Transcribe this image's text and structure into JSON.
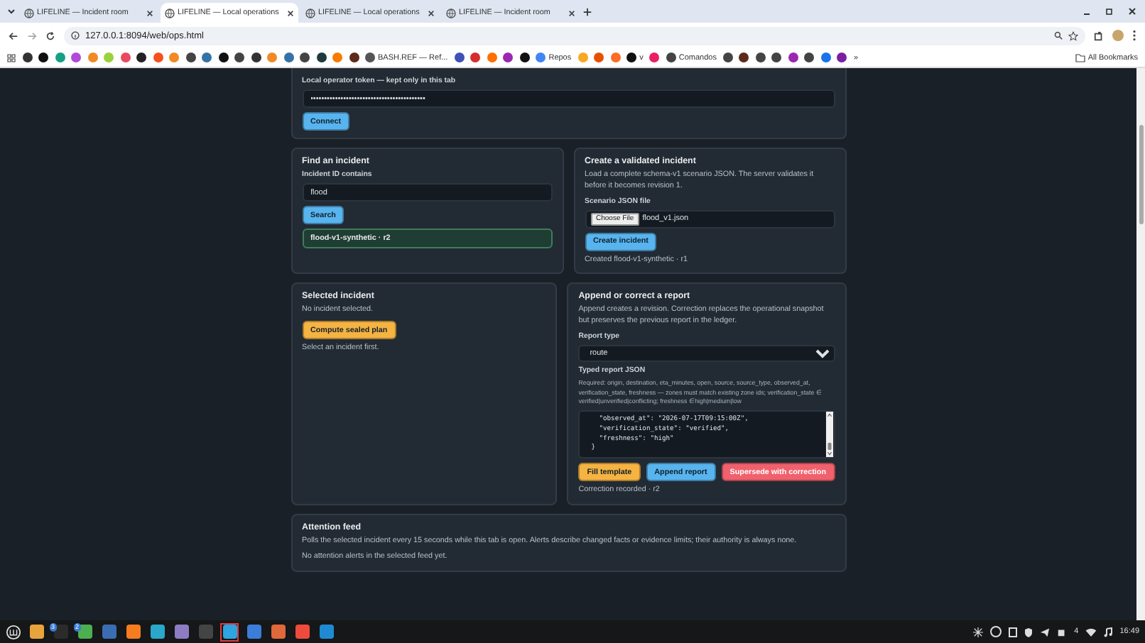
{
  "browser": {
    "tabs": [
      {
        "title": "LIFELINE — Incident room",
        "selected": false
      },
      {
        "title": "LIFELINE — Local operations",
        "selected": true
      },
      {
        "title": "LIFELINE — Local operations",
        "selected": false
      },
      {
        "title": "LIFELINE — Incident room",
        "selected": false
      }
    ],
    "address": "127.0.0.1:8094/web/ops.html",
    "bookmarks": [
      {
        "kind": "icon",
        "color": "#333333"
      },
      {
        "kind": "icon",
        "color": "#111111"
      },
      {
        "kind": "icon",
        "color": "#16a085"
      },
      {
        "kind": "icon",
        "color": "#b04bd8"
      },
      {
        "kind": "icon",
        "color": "#f08a24"
      },
      {
        "kind": "icon",
        "color": "#9bd13b"
      },
      {
        "kind": "icon",
        "color": "#e84a5f"
      },
      {
        "kind": "icon",
        "color": "#222222"
      },
      {
        "kind": "icon",
        "color": "#f4511e"
      },
      {
        "kind": "icon",
        "color": "#f08a24"
      },
      {
        "kind": "icon",
        "color": "#444444"
      },
      {
        "kind": "icon",
        "color": "#3572a5"
      },
      {
        "kind": "icon",
        "color": "#111111"
      },
      {
        "kind": "icon",
        "color": "#444444"
      },
      {
        "kind": "icon",
        "color": "#333333"
      },
      {
        "kind": "icon",
        "color": "#f08a24"
      },
      {
        "kind": "icon",
        "color": "#3572a5"
      },
      {
        "kind": "icon",
        "color": "#444444"
      },
      {
        "kind": "icon",
        "color": "#1e3a3a"
      },
      {
        "kind": "icon",
        "color": "#f57c00"
      },
      {
        "kind": "icon",
        "color": "#5d2a1a"
      },
      {
        "kind": "text",
        "label": "BASH.REF — Ref...",
        "color": "#555555"
      },
      {
        "kind": "icon",
        "color": "#3f51b5"
      },
      {
        "kind": "icon",
        "color": "#d32f2f"
      },
      {
        "kind": "icon",
        "color": "#ff6f00"
      },
      {
        "kind": "icon",
        "color": "#9c27b0"
      },
      {
        "kind": "icon",
        "color": "#111111"
      },
      {
        "kind": "text",
        "label": "Repos",
        "color": "#4285f4"
      },
      {
        "kind": "icon",
        "color": "#f9a825"
      },
      {
        "kind": "icon",
        "color": "#e65100"
      },
      {
        "kind": "icon",
        "color": "#fc6d26"
      },
      {
        "kind": "text",
        "label": "v",
        "color": "#111111"
      },
      {
        "kind": "icon",
        "color": "#e91e63"
      },
      {
        "kind": "text",
        "label": "Comandos",
        "color": "#444444"
      },
      {
        "kind": "icon",
        "color": "#444444"
      },
      {
        "kind": "icon",
        "color": "#5d2a1a"
      },
      {
        "kind": "icon",
        "color": "#444444"
      },
      {
        "kind": "icon",
        "color": "#444444"
      },
      {
        "kind": "icon",
        "color": "#9c27b0"
      },
      {
        "kind": "icon",
        "color": "#444444"
      },
      {
        "kind": "icon",
        "color": "#1a73e8"
      },
      {
        "kind": "icon",
        "color": "#7b1fa2"
      }
    ],
    "overflow": "»",
    "all_bookmarks": "All Bookmarks"
  },
  "connect_panel": {
    "token_label": "Local operator token — kept only in this tab",
    "token_value": "••••••••••••••••••••••••••••••••••••••••••",
    "button": "Connect"
  },
  "find_panel": {
    "title": "Find an incident",
    "field_label": "Incident ID contains",
    "field_value": "flood",
    "button": "Search",
    "results": [
      {
        "label": "flood-v1-synthetic · r2",
        "selected": true
      }
    ]
  },
  "create_panel": {
    "title": "Create a validated incident",
    "description": "Load a complete schema-v1 scenario JSON. The server validates it before it becomes revision 1.",
    "file_label": "Scenario JSON file",
    "file_button": "Choose File",
    "file_name": "flood_v1.json",
    "button": "Create incident",
    "status": "Created flood-v1-synthetic · r1"
  },
  "selected_panel": {
    "title": "Selected incident",
    "status": "No incident selected.",
    "button": "Compute sealed plan",
    "hint": "Select an incident first."
  },
  "report_panel": {
    "title": "Append or correct a report",
    "description": "Append creates a revision. Correction replaces the operational snapshot but preserves the previous report in the ledger.",
    "type_label": "Report type",
    "type_value": "route",
    "json_label": "Typed report JSON",
    "json_help": "Required: origin, destination, eta_minutes, open, source, source_type, observed_at, verification_state, freshness — zones must match existing zone ids; verification_state ∈ verified|unverified|conflicting; freshness ∈ high|medium|low",
    "json_lines": [
      "  \"observed_at\": \"2026-07-17T09:15:00Z\",",
      "  \"verification_state\": \"verified\",",
      "  \"freshness\": \"high\"",
      "}"
    ],
    "buttons": [
      {
        "label": "Fill template",
        "kind": "warning"
      },
      {
        "label": "Append report",
        "kind": "primary"
      },
      {
        "label": "Supersede with correction",
        "kind": "danger"
      }
    ],
    "status": "Correction recorded · r2"
  },
  "attention_panel": {
    "title": "Attention feed",
    "description": "Polls the selected incident every 15 seconds while this tab is open. Alerts describe changed facts or evidence limits; their authority is always none.",
    "status": "No attention alerts in the selected feed yet."
  },
  "taskbar": {
    "apps": [
      {
        "color": "#e8a33d",
        "selected": false
      },
      {
        "color": "#2b2b2b",
        "selected": false,
        "badge": "3"
      },
      {
        "color": "#4caf50",
        "selected": false,
        "badge": "2"
      },
      {
        "color": "#3b6db3",
        "selected": false
      },
      {
        "color": "#f57c20",
        "selected": false
      },
      {
        "color": "#2aa7c9",
        "selected": false
      },
      {
        "color": "#8e7cc3",
        "selected": false
      },
      {
        "color": "#444444",
        "selected": false
      },
      {
        "color": "#2ca5e0",
        "selected": true
      },
      {
        "color": "#3b7dd8",
        "selected": false
      },
      {
        "color": "#e0683a",
        "selected": false
      },
      {
        "color": "#ef4b3c",
        "selected": false
      },
      {
        "color": "#1f8ad2",
        "selected": false
      }
    ],
    "tray_count": "4",
    "clock": "16:49"
  }
}
